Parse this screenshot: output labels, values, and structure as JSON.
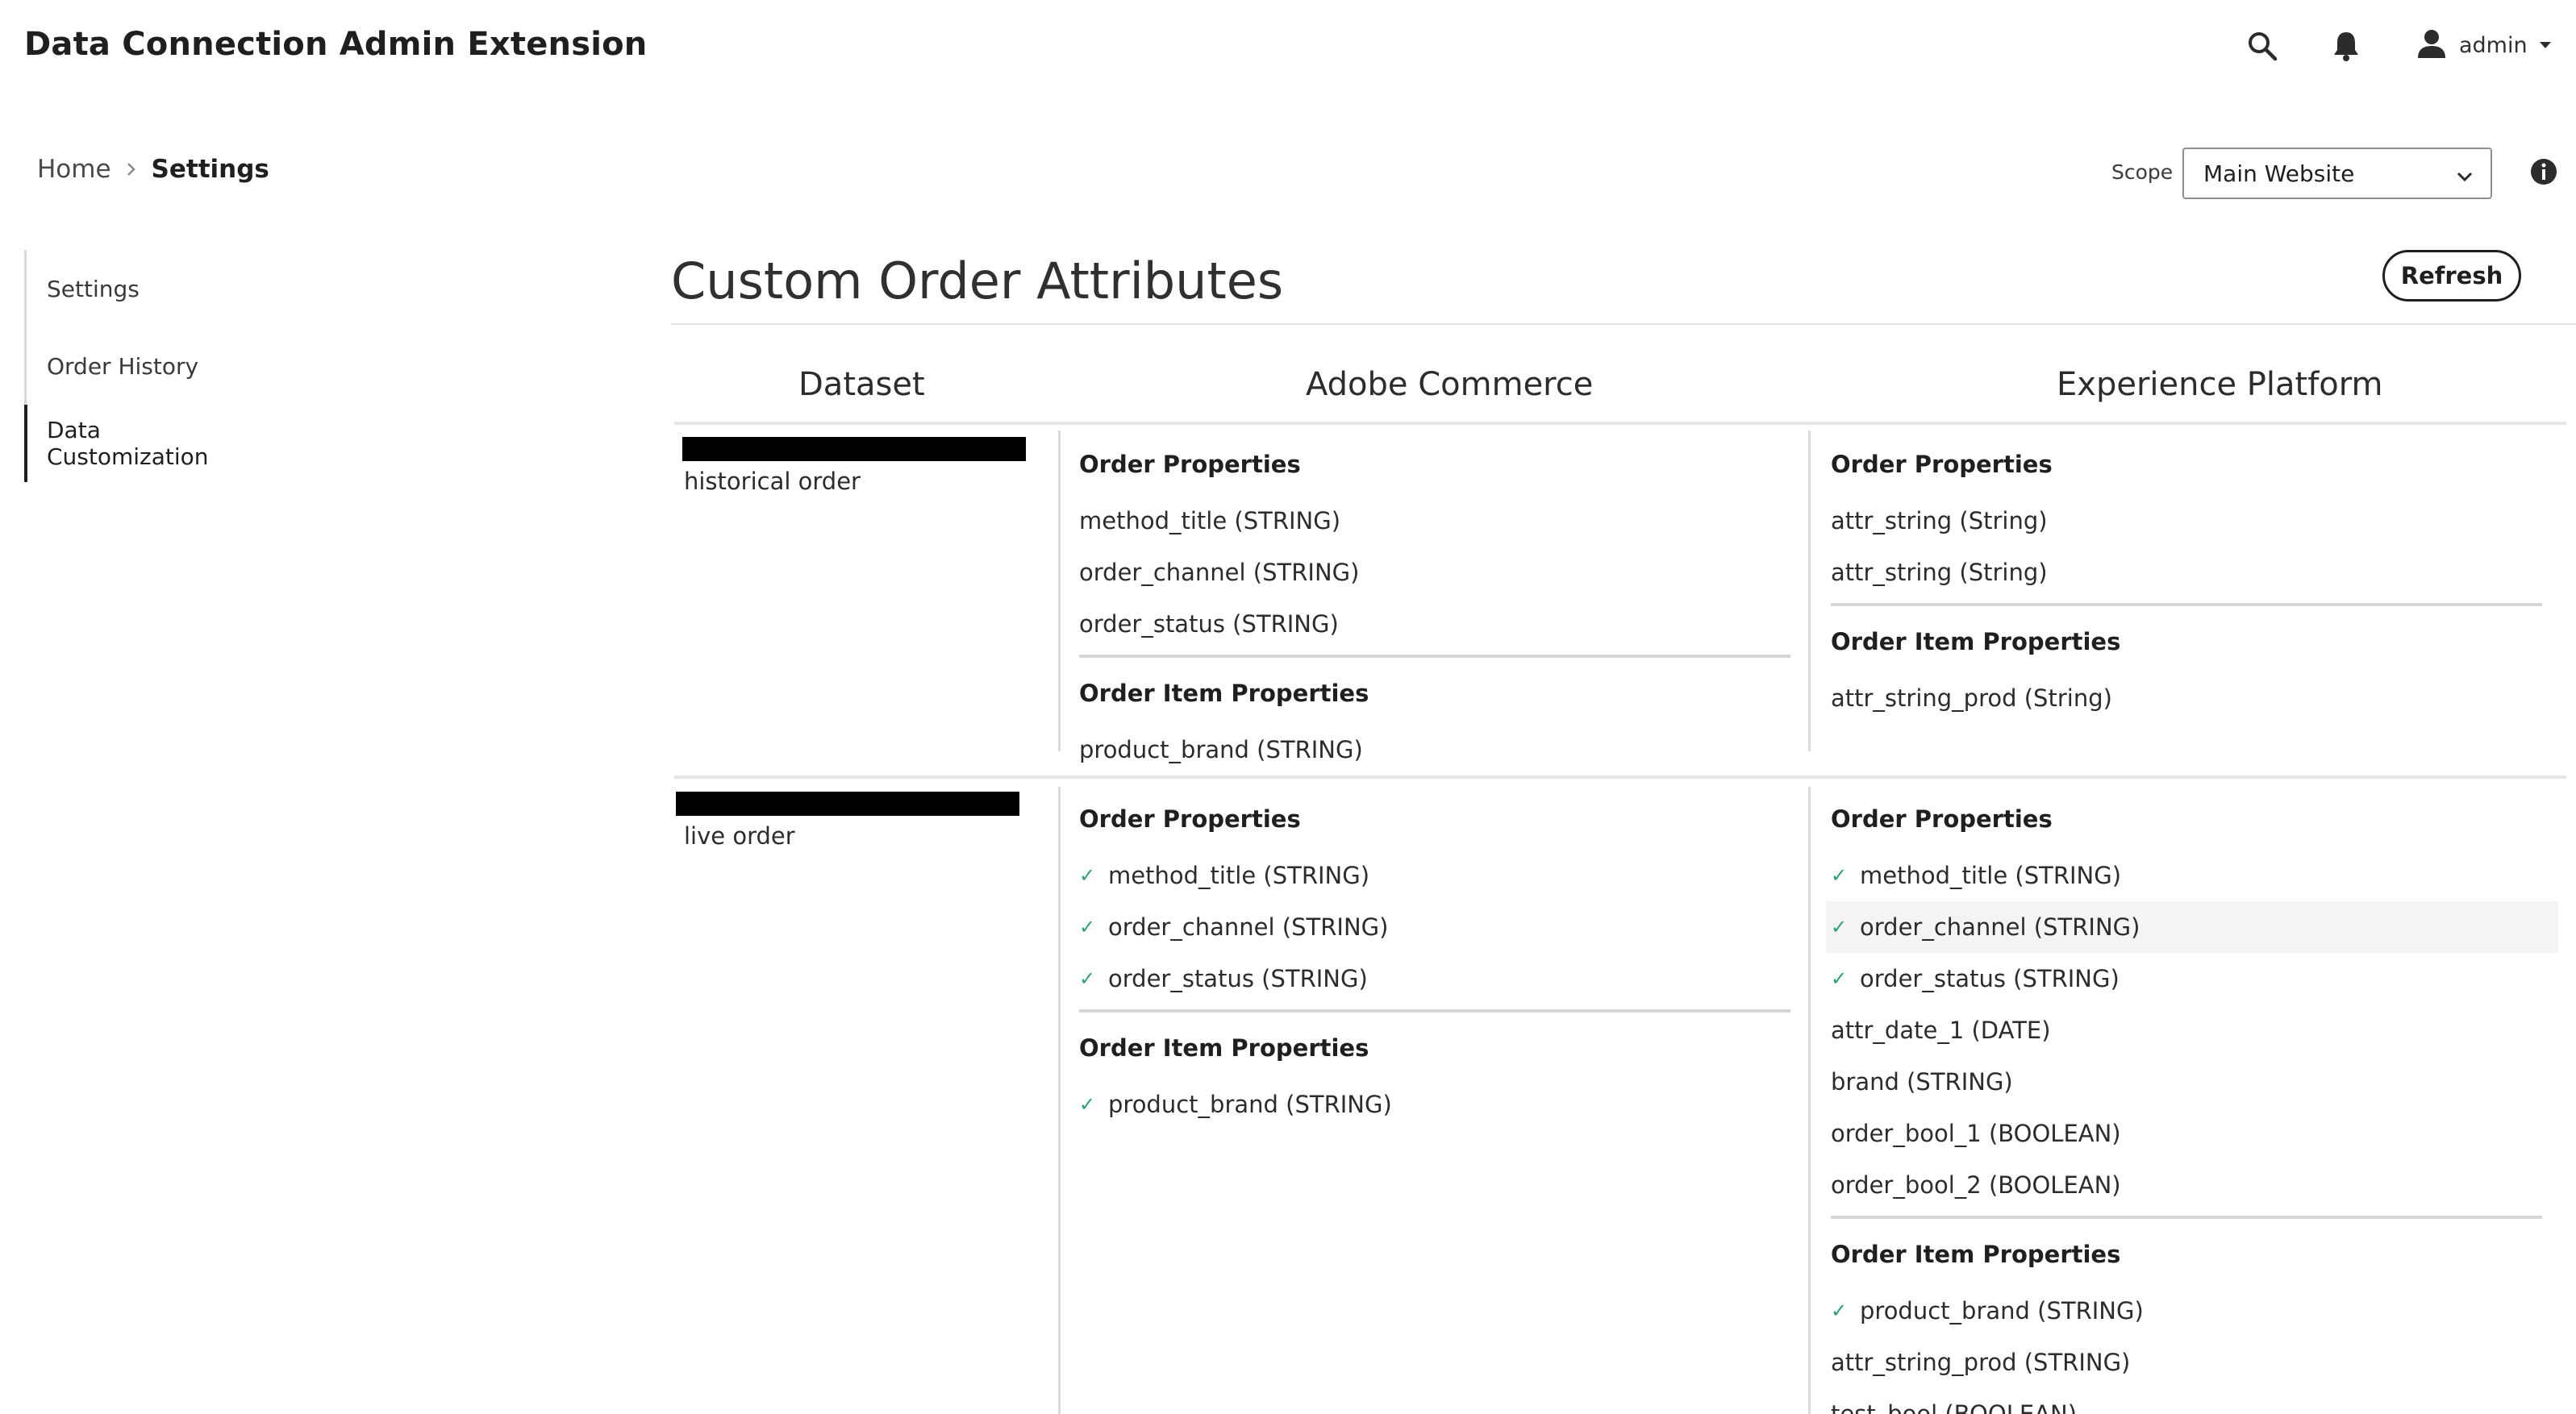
{
  "header": {
    "app_title": "Data Connection Admin Extension",
    "user": {
      "name": "admin"
    }
  },
  "breadcrumb": {
    "home": "Home",
    "current": "Settings"
  },
  "scope": {
    "label": "Scope",
    "selected": "Main Website"
  },
  "sidebar": {
    "items": [
      {
        "label": "Settings"
      },
      {
        "label": "Order History"
      },
      {
        "label": "Data Customization"
      }
    ]
  },
  "main": {
    "title": "Custom Order Attributes",
    "refresh_label": "Refresh",
    "columns": {
      "dataset": "Dataset",
      "commerce": "Adobe Commerce",
      "platform": "Experience Platform"
    },
    "rows": [
      {
        "dataset": "historical order",
        "commerce": {
          "order_heading": "Order Properties",
          "order": [
            {
              "label": "method_title (STRING)"
            },
            {
              "label": "order_channel (STRING)"
            },
            {
              "label": "order_status (STRING)"
            }
          ],
          "item_heading": "Order Item Properties",
          "items": [
            {
              "label": "product_brand (STRING)"
            }
          ]
        },
        "platform": {
          "order_heading": "Order Properties",
          "order": [
            {
              "label": "attr_string (String)"
            },
            {
              "label": "attr_string (String)"
            }
          ],
          "item_heading": "Order Item Properties",
          "items": [
            {
              "label": "attr_string_prod (String)"
            }
          ]
        }
      },
      {
        "dataset": "live order",
        "commerce": {
          "order_heading": "Order Properties",
          "order": [
            {
              "label": "method_title (STRING)",
              "check": "✓"
            },
            {
              "label": "order_channel (STRING)",
              "check": "✓"
            },
            {
              "label": "order_status (STRING)",
              "check": "✓"
            }
          ],
          "item_heading": "Order Item Properties",
          "items": [
            {
              "label": "product_brand (STRING)",
              "check": "✓"
            }
          ]
        },
        "platform": {
          "order_heading": "Order Properties",
          "order": [
            {
              "label": "method_title (STRING)",
              "check": "✓"
            },
            {
              "label": "order_channel (STRING)",
              "check": "✓"
            },
            {
              "label": "order_status (STRING)",
              "check": "✓"
            },
            {
              "label": "attr_date_1 (DATE)"
            },
            {
              "label": "brand (STRING)"
            },
            {
              "label": "order_bool_1 (BOOLEAN)"
            },
            {
              "label": "order_bool_2 (BOOLEAN)"
            }
          ],
          "item_heading": "Order Item Properties",
          "items": [
            {
              "label": "product_brand (STRING)",
              "check": "✓"
            },
            {
              "label": "attr_string_prod (STRING)"
            },
            {
              "label": "test_bool (BOOLEAN)"
            }
          ]
        }
      }
    ]
  }
}
